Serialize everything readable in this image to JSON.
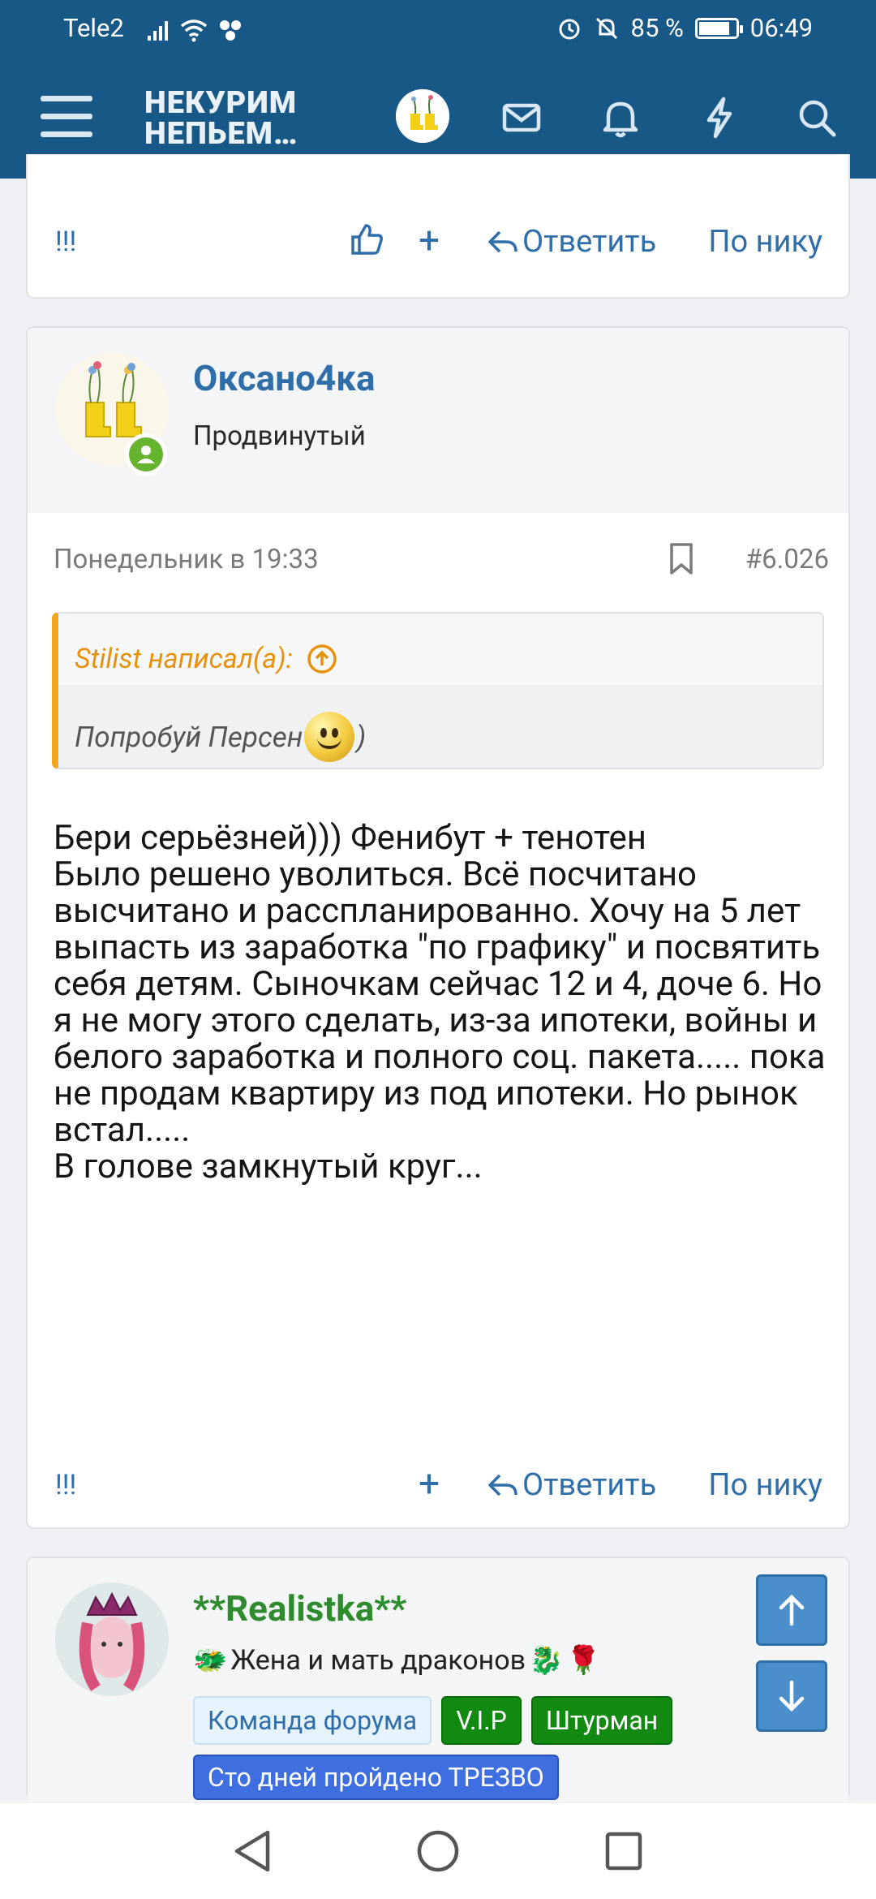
{
  "status_bar": {
    "carrier": "Tele2",
    "battery_percent": "85 %",
    "battery_level": 0.85,
    "time": "06:49",
    "icons": [
      "signal-icon",
      "wifi-icon",
      "apps-icon",
      "alarm-icon",
      "mute-icon",
      "battery-icon"
    ]
  },
  "app_bar": {
    "logo_line1": "НЕКУРИМ",
    "logo_line2": "НЕПЬЕМ…",
    "icons": [
      "menu-icon",
      "user-avatar",
      "mail-icon",
      "bell-icon",
      "lightning-icon",
      "search-icon"
    ]
  },
  "post_prev": {
    "marks": "!!!",
    "plus": "+",
    "reply_label": "Ответить",
    "by_nick_label": "По нику"
  },
  "post": {
    "username": "Оксано4ка",
    "user_title": "Продвинутый",
    "date": "Понедельник в 19:33",
    "post_number": "#6.026",
    "quote": {
      "author": "Stilist написал(а):",
      "text_before": "Попробуй Персен",
      "text_after": ")"
    },
    "message_lines": [
      "Бери серьёзней))) Фенибут + тенотен",
      "Было решено уволиться. Всё посчитано высчитано и расспланированно. Хочу на 5 лет выпасть из заработка \"по графику\" и посвятить себя детям. Сыночкам сейчас 12 и 4, доче 6. Но я не могу этого сделать, из-за ипотеки, войны и белого заработка и полного соц. пакета..... пока не продам квартиру из под ипотеки. Но рынок встал.....",
      "В голове замкнутый круг..."
    ],
    "marks": "!!!",
    "plus": "+",
    "reply_label": "Ответить",
    "by_nick_label": "По нику"
  },
  "post_next": {
    "username": "**Realistka**",
    "tagline": "Жена и мать драконов",
    "badges": [
      "Команда форума",
      "V.I.P",
      "Штурман",
      "Сто дней пройдено ТРЕЗВО"
    ]
  },
  "scroll_buttons": {
    "up": "arrow-up-icon",
    "down": "arrow-down-icon"
  },
  "colors": {
    "header_bg": "#185886",
    "link": "#2f6ea8",
    "quote_accent": "#f2a51a",
    "online": "#65b32e",
    "vip_badge": "#128a12",
    "sober_badge": "#3e6ee0"
  }
}
